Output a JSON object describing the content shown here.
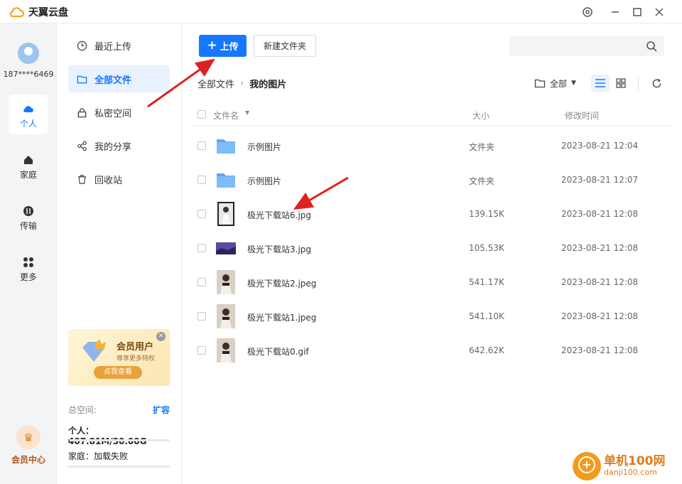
{
  "app": {
    "title": "天翼云盘"
  },
  "rail": {
    "user": "187****6469",
    "items": [
      {
        "label": "个人",
        "icon": "cloud-icon",
        "active": true
      },
      {
        "label": "家庭",
        "icon": "home-icon"
      },
      {
        "label": "传输",
        "icon": "transfer-icon"
      },
      {
        "label": "更多",
        "icon": "grid-icon"
      }
    ],
    "vip_label": "会员中心"
  },
  "nav": {
    "items": [
      {
        "label": "最近上传",
        "icon": "clock-icon"
      },
      {
        "label": "全部文件",
        "icon": "folder-icon",
        "active": true
      },
      {
        "label": "私密空间",
        "icon": "lock-icon"
      },
      {
        "label": "我的分享",
        "icon": "share-icon"
      },
      {
        "label": "回收站",
        "icon": "trash-icon"
      }
    ],
    "promo": {
      "title": "会员用户",
      "subtitle": "尊享更多特权",
      "button": "点我查看"
    },
    "storage": {
      "total_label": "总空间:",
      "expand": "扩容",
      "personal": "个人：407.81M/30.00G",
      "personal_fraction": 0.013,
      "family": "家庭：加载失败"
    }
  },
  "toolbar": {
    "upload": "上传",
    "new_folder": "新建文件夹",
    "search_placeholder": ""
  },
  "breadcrumb": {
    "root": "全部文件",
    "current": "我的图片"
  },
  "filter": {
    "label": "全部"
  },
  "table": {
    "headers": {
      "name": "文件名",
      "size": "大小",
      "time": "修改时间"
    },
    "rows": [
      {
        "name": "示例图片",
        "size": "文件夹",
        "time": "2023-08-21 12:04",
        "kind": "folder"
      },
      {
        "name": "示例图片",
        "size": "文件夹",
        "time": "2023-08-21 12:07",
        "kind": "folder"
      },
      {
        "name": "极光下载站6.jpg",
        "size": "139.15K",
        "time": "2023-08-21 12:08",
        "kind": "photo-dark"
      },
      {
        "name": "极光下载站3.jpg",
        "size": "105.53K",
        "time": "2023-08-21 12:08",
        "kind": "photo-purple"
      },
      {
        "name": "极光下载站2.jpeg",
        "size": "541.17K",
        "time": "2023-08-21 12:08",
        "kind": "photo-light"
      },
      {
        "name": "极光下载站1.jpeg",
        "size": "541.10K",
        "time": "2023-08-21 12:08",
        "kind": "photo-light"
      },
      {
        "name": "极光下载站0.gif",
        "size": "642.62K",
        "time": "2023-08-21 12:08",
        "kind": "photo-light"
      }
    ]
  },
  "watermark": {
    "name": "单机100网",
    "url": "danji100.com"
  },
  "colors": {
    "accent": "#1677ff",
    "annotation": "#e02020"
  }
}
